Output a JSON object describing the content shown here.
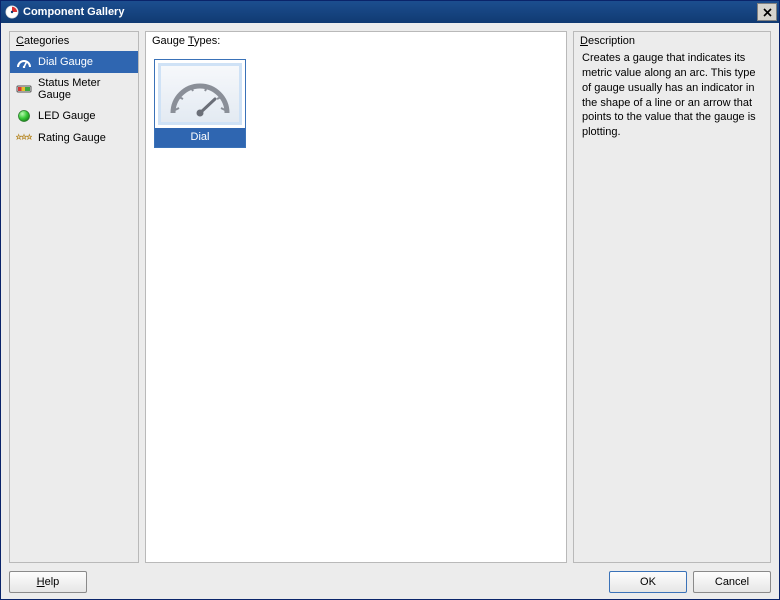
{
  "window": {
    "title": "Component Gallery"
  },
  "categories": {
    "heading_prefix": "C",
    "heading_rest": "ategories",
    "items": [
      {
        "label": "Dial Gauge",
        "icon": "dial-gauge-icon",
        "selected": true
      },
      {
        "label": "Status Meter Gauge",
        "icon": "status-meter-icon",
        "selected": false
      },
      {
        "label": "LED Gauge",
        "icon": "led-icon",
        "selected": false
      },
      {
        "label": "Rating Gauge",
        "icon": "rating-stars-icon",
        "selected": false
      }
    ]
  },
  "gauge_types": {
    "heading_pre": "Gauge ",
    "heading_u": "T",
    "heading_post": "ypes:",
    "items": [
      {
        "label": "Dial",
        "icon": "dial-thumbnail-icon",
        "selected": true
      }
    ]
  },
  "description": {
    "heading_prefix": "D",
    "heading_rest": "escription",
    "text": "Creates a gauge that indicates its metric value along an arc. This type of gauge usually has an indicator in the shape of a line or an arrow that points to the value that the gauge is plotting."
  },
  "buttons": {
    "help_u": "H",
    "help_rest": "elp",
    "ok": "OK",
    "cancel": "Cancel"
  }
}
